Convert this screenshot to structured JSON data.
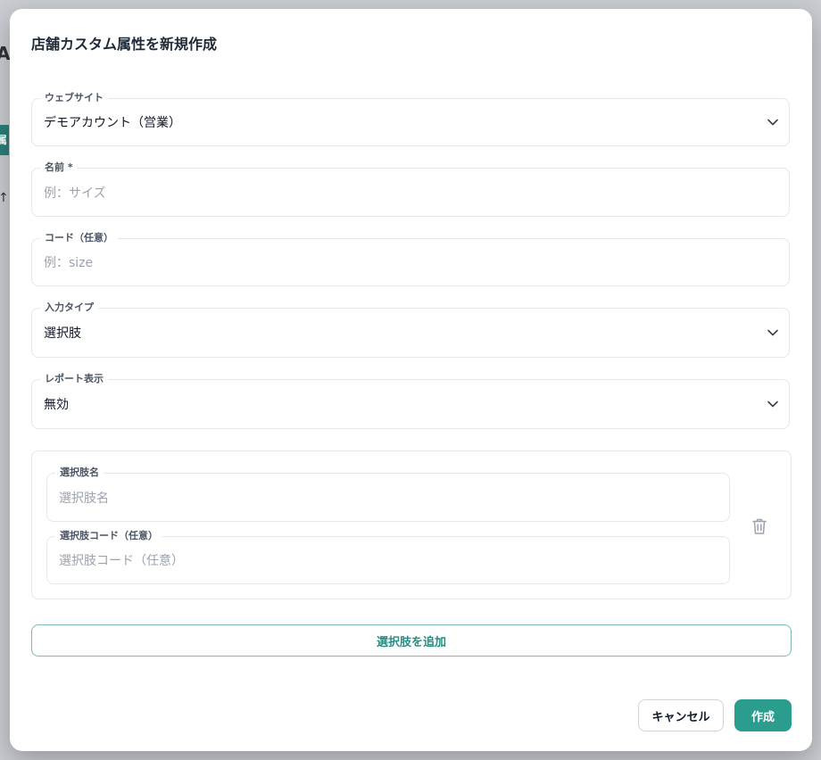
{
  "background": {
    "fragment_top": "A",
    "fragment_tab": "属",
    "fragment_arrow": "↑"
  },
  "dialog": {
    "title": "店舗カスタム属性を新規作成"
  },
  "fields": {
    "website": {
      "label": "ウェブサイト",
      "value": "デモアカウント（営業）",
      "icon": "chevron-down-icon"
    },
    "name": {
      "label": "名前 *",
      "placeholder": "例：サイズ"
    },
    "code": {
      "label": "コード（任意）",
      "placeholder": "例：size"
    },
    "input_type": {
      "label": "入力タイプ",
      "value": "選択肢",
      "icon": "chevron-down-icon"
    },
    "report_display": {
      "label": "レポート表示",
      "value": "無効",
      "icon": "chevron-down-icon"
    }
  },
  "choices": [
    {
      "name_label": "選択肢名",
      "name_placeholder": "選択肢名",
      "code_label": "選択肢コード（任意）",
      "code_placeholder": "選択肢コード（任意）",
      "delete_icon": "trash-icon"
    }
  ],
  "actions": {
    "add_choice": "選択肢を追加",
    "cancel": "キャンセル",
    "create": "作成"
  },
  "colors": {
    "accent": "#2a9d8f",
    "accent_outline": "#7fb9b3",
    "overlay": "#8a8e93"
  }
}
